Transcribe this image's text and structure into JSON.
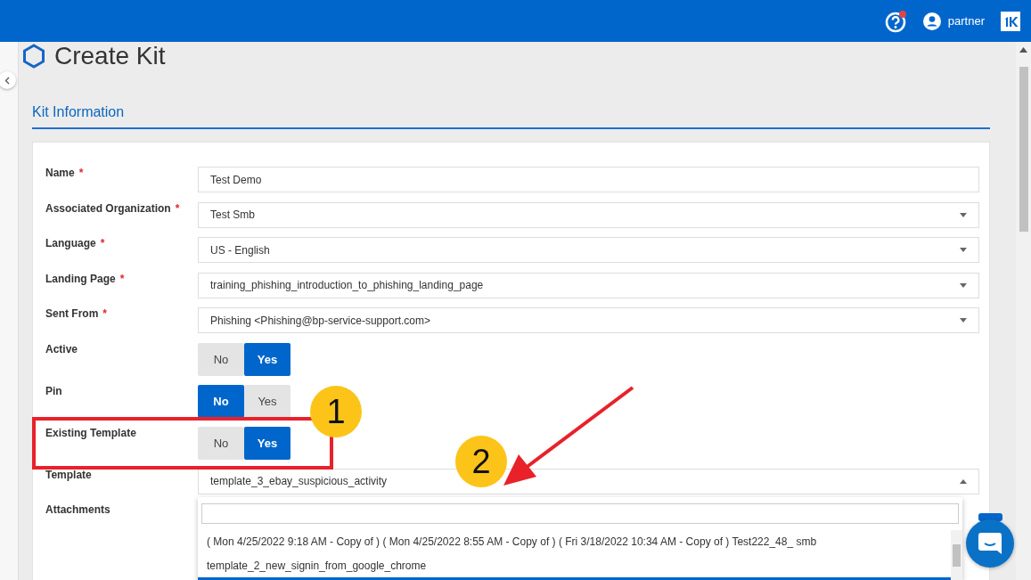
{
  "topbar": {
    "has_help_alert": true,
    "user": "partner"
  },
  "page": {
    "title": "Create Kit",
    "section": "Kit Information"
  },
  "fields": [
    {
      "kind": "text",
      "label": "Name",
      "required_mark": "*",
      "value": "Test Demo"
    },
    {
      "kind": "select",
      "label": "Associated Organization",
      "required_mark": "*",
      "value": "Test Smb"
    },
    {
      "kind": "select",
      "label": "Language",
      "required_mark": "*",
      "value": "US - English"
    },
    {
      "kind": "select",
      "label": "Landing Page",
      "required_mark": "*",
      "value": "training_phishing_introduction_to_phishing_landing_page"
    },
    {
      "kind": "select",
      "label": "Sent From",
      "required_mark": "*",
      "value": "Phishing <Phishing@bp-service-support.com>"
    },
    {
      "kind": "toggle",
      "label": "Active",
      "options": [
        {
          "label": "No",
          "selected": false
        },
        {
          "label": "Yes",
          "selected": true
        }
      ]
    },
    {
      "kind": "toggle",
      "label": "Pin",
      "options": [
        {
          "label": "No",
          "selected": true
        },
        {
          "label": "Yes",
          "selected": false
        }
      ]
    },
    {
      "kind": "toggle",
      "label": "Existing Template",
      "options": [
        {
          "label": "No",
          "selected": false
        },
        {
          "label": "Yes",
          "selected": true
        }
      ]
    },
    {
      "kind": "select",
      "label": "Template",
      "value": "template_3_ebay_suspicious_activity",
      "expanded": true
    },
    {
      "kind": "label",
      "label": "Attachments"
    }
  ],
  "dropdown": {
    "options": [
      {
        "label": "( Mon 4/25/2022 9:18 AM - Copy of ) ( Mon 4/25/2022 8:55 AM - Copy of ) ( Fri 3/18/2022 10:34 AM - Copy of ) Test222_48_ smb",
        "selected": false
      },
      {
        "label": "template_2_new_signin_from_google_chrome",
        "selected": false
      },
      {
        "selected": true
      }
    ]
  },
  "annotations": [
    {
      "number": "1"
    },
    {
      "number": "2"
    }
  ]
}
